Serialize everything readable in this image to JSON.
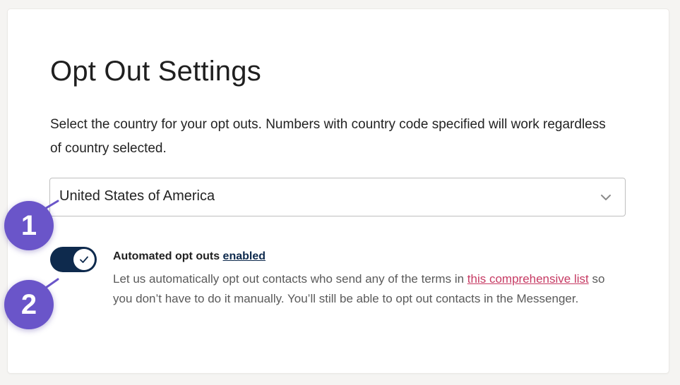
{
  "page": {
    "title": "Opt Out Settings",
    "description": "Select the country for your opt outs. Numbers with country code specified will work regardless of country selected."
  },
  "country_select": {
    "selected": "United States of America",
    "icon": "chevron-down-icon"
  },
  "auto_opt_out": {
    "toggle_on": true,
    "heading_prefix": "Automated opt outs",
    "state_label": "enabled",
    "body_before_link": "Let us automatically opt out contacts who send any of the terms in ",
    "link_text": "this comprehensive list",
    "body_after_link": " so you don’t have to do it manually. You’ll still be able to opt out contacts in the Messenger."
  },
  "annotations": {
    "badge_1": "1",
    "badge_2": "2",
    "badge_color": "#6a55c9"
  },
  "colors": {
    "toggle_on": "#0e2a4d",
    "link": "#c63a63"
  }
}
